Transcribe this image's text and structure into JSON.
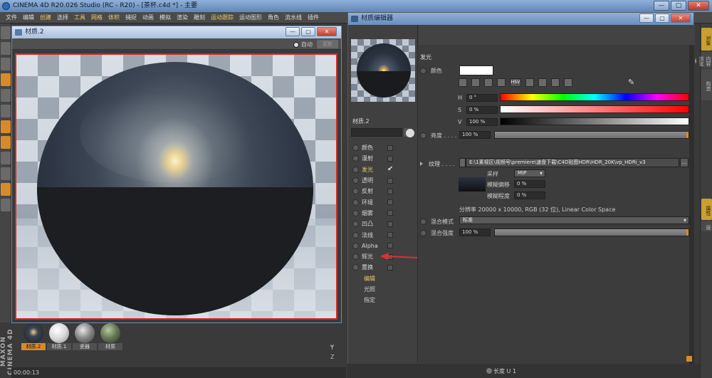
{
  "app": {
    "title": "CINEMA 4D R20.026 Studio (RC - R20) - [茶杯.c4d *] - 主要",
    "window_controls": [
      "—",
      "▢",
      "✕"
    ]
  },
  "menubar": {
    "items": [
      "文件",
      "编辑",
      "创建",
      "选择",
      "工具",
      "网格",
      "体积",
      "捕捉",
      "动画",
      "模拟",
      "渲染",
      "雕刻",
      "运动跟踪",
      "运动图形",
      "角色",
      "流水线",
      "插件"
    ]
  },
  "material_window": {
    "title": "材质.2",
    "auto_label": "自动",
    "refresh_label": "更新"
  },
  "thumbnails": [
    {
      "label": "材质.2",
      "color": "#2a3038"
    },
    {
      "label": "材质.1",
      "color": "#e8e8e8"
    },
    {
      "label": "瓷器",
      "color": "#9a9a9a"
    },
    {
      "label": "材质",
      "color": "#6a7a5a"
    }
  ],
  "status": {
    "time": "00:00:13",
    "axis_y": "Y",
    "axis_z": "Z",
    "length_label": "长度 U",
    "length_value": "1"
  },
  "logo": "MAXON CINEMA 4D",
  "right_tabs": [
    "对象",
    "内容浏览器",
    "构造",
    "属性",
    "层"
  ],
  "editor": {
    "title": "材质编辑器",
    "material_name": "材质.2",
    "channels": [
      {
        "name": "颜色",
        "checked": false
      },
      {
        "name": "漫射",
        "checked": false
      },
      {
        "name": "发光",
        "checked": true,
        "selected": true
      },
      {
        "name": "透明",
        "checked": false
      },
      {
        "name": "反射",
        "checked": false
      },
      {
        "name": "环境",
        "checked": false
      },
      {
        "name": "烟雾",
        "checked": false
      },
      {
        "name": "凹凸",
        "checked": false
      },
      {
        "name": "法线",
        "checked": false
      },
      {
        "name": "Alpha",
        "checked": false
      },
      {
        "name": "辉光",
        "checked": false
      },
      {
        "name": "置换",
        "checked": false
      }
    ],
    "sub_items": [
      "编辑",
      "光照",
      "指定"
    ],
    "section": "发光",
    "color_label": "颜色",
    "color_value": "#ffffff",
    "hsv": [
      {
        "label": "H",
        "value": "0 °"
      },
      {
        "label": "S",
        "value": "0 %"
      },
      {
        "label": "V",
        "value": "100 %"
      }
    ],
    "brightness_label": "亮度 . . . .",
    "brightness_value": "100 %",
    "brightness_level": 1.0,
    "texture_label": "纹理 . . . .",
    "texture_path": "E:\\1素视区\\视频号\\premiere\\速盘下载\\C4D贴图HDR\\HDR_20K\\vp_HDRi_v3",
    "texture_more": "...",
    "sampling_label": "采样",
    "sampling_value": "MIP",
    "blur_offset_label": "模糊偏移",
    "blur_offset_value": "0 %",
    "blur_scale_label": "模糊程度",
    "blur_scale_value": "0 %",
    "resolution_text": "分辨率 20000 x 10000, RGB (32 位), Linear Color Space",
    "mix_mode_label": "混合模式",
    "mix_mode_value": "标准",
    "mix_strength_label": "混合强度",
    "mix_strength_value": "100 %",
    "mix_strength_level": 1.0
  }
}
